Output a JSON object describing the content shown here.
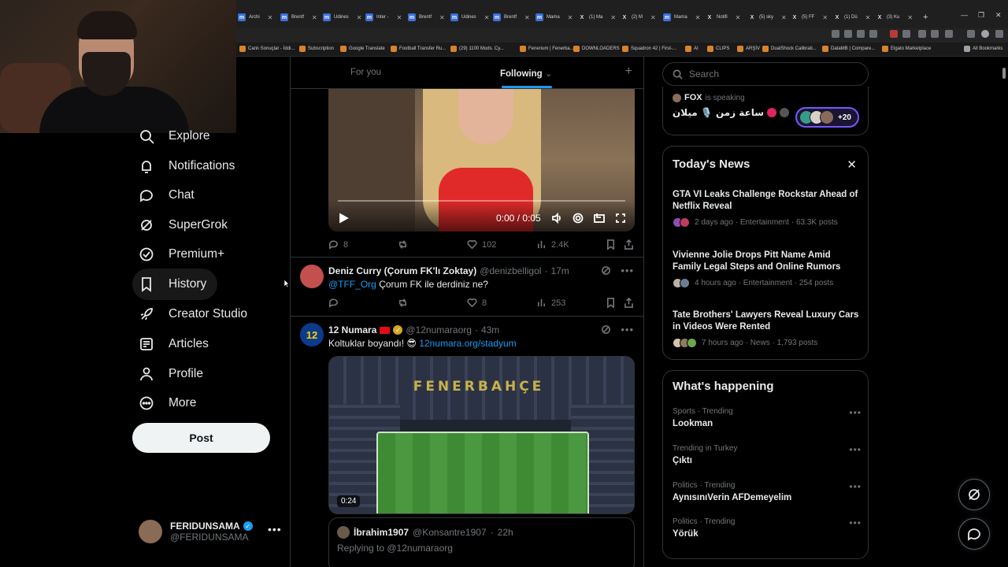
{
  "browser": {
    "tabs": [
      {
        "icon": "m",
        "label": "Archi"
      },
      {
        "icon": "m",
        "label": "Brentf"
      },
      {
        "icon": "m",
        "label": "Udines"
      },
      {
        "icon": "m",
        "label": "Inter -"
      },
      {
        "icon": "m",
        "label": "Brentf"
      },
      {
        "icon": "m",
        "label": "Udines"
      },
      {
        "icon": "m",
        "label": "Brentf"
      },
      {
        "icon": "m",
        "label": "Mama"
      },
      {
        "icon": "X",
        "label": "(1) Ma"
      },
      {
        "icon": "X",
        "label": "(2) M"
      },
      {
        "icon": "m",
        "label": "Mama"
      },
      {
        "icon": "X",
        "label": "Notifi"
      },
      {
        "icon": "X",
        "label": "(5) sky"
      },
      {
        "icon": "X",
        "label": "(5) FF"
      },
      {
        "icon": "X",
        "label": "(1) Dü"
      },
      {
        "icon": "X",
        "label": "(3) Ku"
      }
    ],
    "bookmarks": [
      "Canlı Sonuçlar - İddi...",
      "Subscription",
      "Google Translate",
      "Football Transfer Ru...",
      "(29) 1100 Mods. Cy...",
      "Fenerium | Fenerba...",
      "DOWNLOADERS",
      "Squadron 42 | First-...",
      "AI",
      "CLIPS",
      "ARŞİV",
      "DualShock Calibrati...",
      "DataMB | Compare...",
      "Elgato Marketplace"
    ],
    "all_bookmarks": "All Bookmarks"
  },
  "nav": {
    "items": [
      {
        "label": "Explore",
        "icon": "search-icon"
      },
      {
        "label": "Notifications",
        "icon": "bell-icon"
      },
      {
        "label": "Chat",
        "icon": "chat-icon"
      },
      {
        "label": "SuperGrok",
        "icon": "grok-icon"
      },
      {
        "label": "Premium+",
        "icon": "premium-icon"
      },
      {
        "label": "History",
        "icon": "bookmark-icon"
      },
      {
        "label": "Creator Studio",
        "icon": "rocket-icon"
      },
      {
        "label": "Articles",
        "icon": "articles-icon"
      },
      {
        "label": "Profile",
        "icon": "person-icon"
      },
      {
        "label": "More",
        "icon": "more-circle-icon"
      }
    ],
    "post_label": "Post",
    "account": {
      "name": "FERIDUNSAMA",
      "handle": "@FERIDUNSAMA"
    }
  },
  "timeline": {
    "tabs": {
      "for_you": "For you",
      "following": "Following"
    },
    "video1": {
      "time": "0:00 / 0:05"
    },
    "tweet1_actions": {
      "replies": "8",
      "likes": "102",
      "views": "2.4K"
    },
    "tweet2": {
      "name": "Deniz Curry (Çorum FK'lı Zoktay)",
      "handle": "@denizbelligol",
      "time": "17m",
      "mention": "@TFF_Org",
      "text": " Çorum FK ile derdiniz ne?",
      "likes": "8",
      "views": "253"
    },
    "tweet3": {
      "name": "12 Numara",
      "handle": "@12numaraorg",
      "time": "43m",
      "text": "Koltuklar boyandı! 😎",
      "link": "12numara.org/stadyum",
      "video_time": "0:24",
      "banner": "FENERBAHÇE",
      "avatar_text": "12"
    },
    "quote": {
      "name": "İbrahim1907",
      "handle": "@Konsantre1907",
      "time": "22h",
      "reply": "Replying to @12numaraorg"
    }
  },
  "right": {
    "search_placeholder": "Search",
    "space": {
      "host": "FOX",
      "status": "is speaking",
      "title": "ساعة زمن 🎙️ ميلان",
      "listeners": "+20"
    },
    "news": {
      "title": "Today's News",
      "items": [
        {
          "title": "GTA VI Leaks Challenge Rockstar Ahead of Netflix Reveal",
          "meta": "2 days ago · Entertainment · 63.3K posts"
        },
        {
          "title": "Vivienne Jolie Drops Pitt Name Amid Family Legal Steps and Online Rumors",
          "meta": "4 hours ago · Entertainment · 254 posts"
        },
        {
          "title": "Tate Brothers' Lawyers Reveal Luxury Cars in Videos Were Rented",
          "meta": "7 hours ago · News · 1,793 posts"
        }
      ]
    },
    "happening": {
      "title": "What's happening",
      "trends": [
        {
          "category": "Sports · Trending",
          "name": "Lookman"
        },
        {
          "category": "Trending in Turkey",
          "name": "Çıktı"
        },
        {
          "category": "Politics · Trending",
          "name": "AynısınıVerin AFDemeyelim"
        },
        {
          "category": "Politics · Trending",
          "name": "Yörük"
        }
      ]
    }
  },
  "colors": {
    "accent": "#1d9bf0",
    "background": "#000000",
    "border": "#2f3336",
    "muted": "#71767b"
  }
}
